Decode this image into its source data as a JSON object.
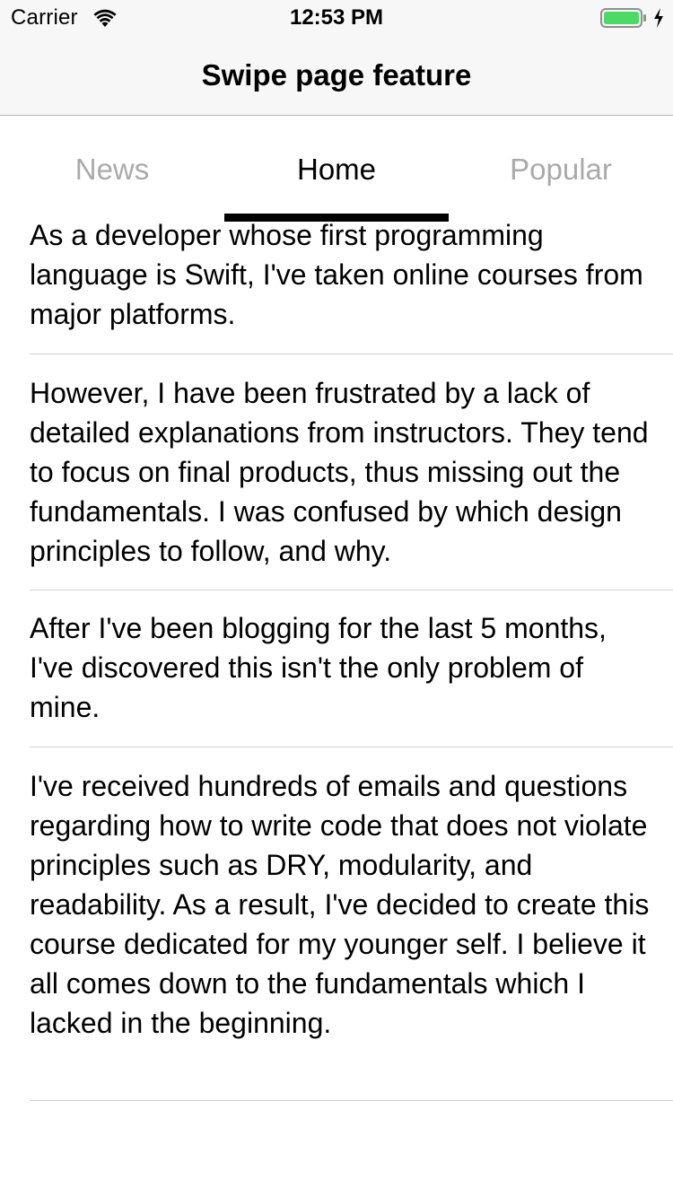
{
  "status_bar": {
    "carrier": "Carrier",
    "time": "12:53 PM",
    "wifi_icon": "wifi-icon",
    "battery_icon": "battery-icon",
    "charging_icon": "charging-bolt-icon",
    "battery_color": "#4cd964"
  },
  "nav": {
    "title": "Swipe page feature"
  },
  "tabs": [
    {
      "label": "News",
      "active": false
    },
    {
      "label": "Home",
      "active": true
    },
    {
      "label": "Popular",
      "active": false
    }
  ],
  "list": {
    "items": [
      {
        "text": "As a developer whose first programming language is Swift, I've taken online courses from major platforms."
      },
      {
        "text": "However, I have been frustrated by a lack of detailed explanations from instructors. They tend to focus on final products, thus missing out the fundamentals. I was confused by which design principles to follow, and why."
      },
      {
        "text": "After I've been blogging for the last 5 months, I've discovered this isn't the only problem of mine."
      },
      {
        "text": "I've received hundreds of emails and questions regarding how to write code that does not violate principles such as DRY, modularity, and readability. As a result, I've decided to create this course dedicated for my younger self. I believe it all comes down to the fundamentals which I lacked in the beginning."
      }
    ]
  },
  "colors": {
    "inactive_tab": "#aaaaaa",
    "active_tab": "#000000",
    "indicator": "#000000",
    "nav_background": "#f7f7f7",
    "separator": "#cfcfd2"
  }
}
